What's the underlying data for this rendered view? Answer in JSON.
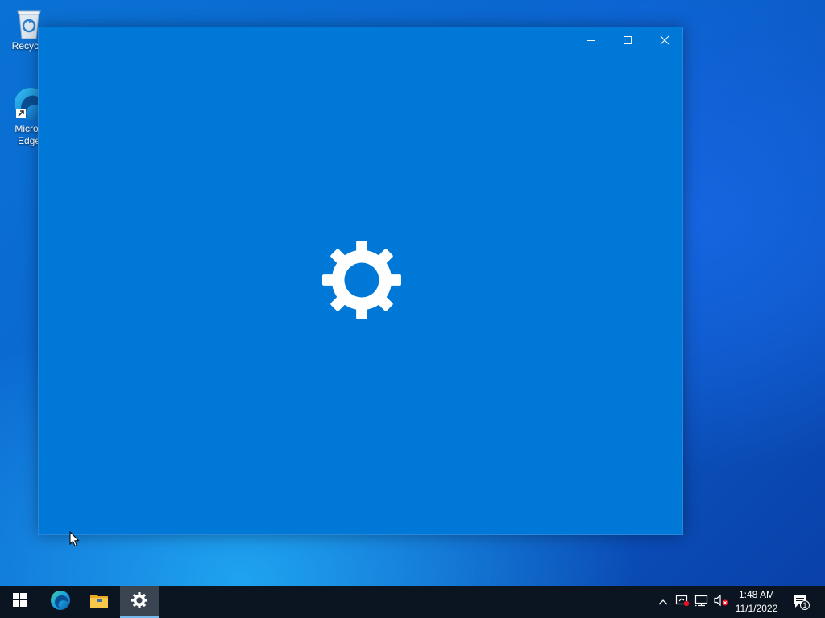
{
  "desktop": {
    "icons": [
      {
        "label": "Recycle",
        "icon": "recycle-bin-icon"
      },
      {
        "label": "Micros Edge",
        "icon": "edge-icon"
      }
    ]
  },
  "window": {
    "title": "",
    "splash_icon": "gear-icon",
    "background": "#0078d7",
    "controls": [
      "minimize-icon",
      "maximize-icon",
      "close-icon"
    ]
  },
  "taskbar": {
    "apps": [
      {
        "name": "start",
        "icon": "windows-logo-icon"
      },
      {
        "name": "edge",
        "icon": "edge-icon"
      },
      {
        "name": "file-explorer",
        "icon": "folder-icon"
      },
      {
        "name": "settings",
        "icon": "gear-icon",
        "active": true
      }
    ],
    "tray": {
      "icons": [
        "chevron-up-icon",
        "security-icon",
        "network-icon",
        "volume-muted-icon"
      ],
      "time": "1:48 AM",
      "date": "11/1/2022",
      "notifications": "1"
    },
    "accent": "#76b9ed"
  }
}
